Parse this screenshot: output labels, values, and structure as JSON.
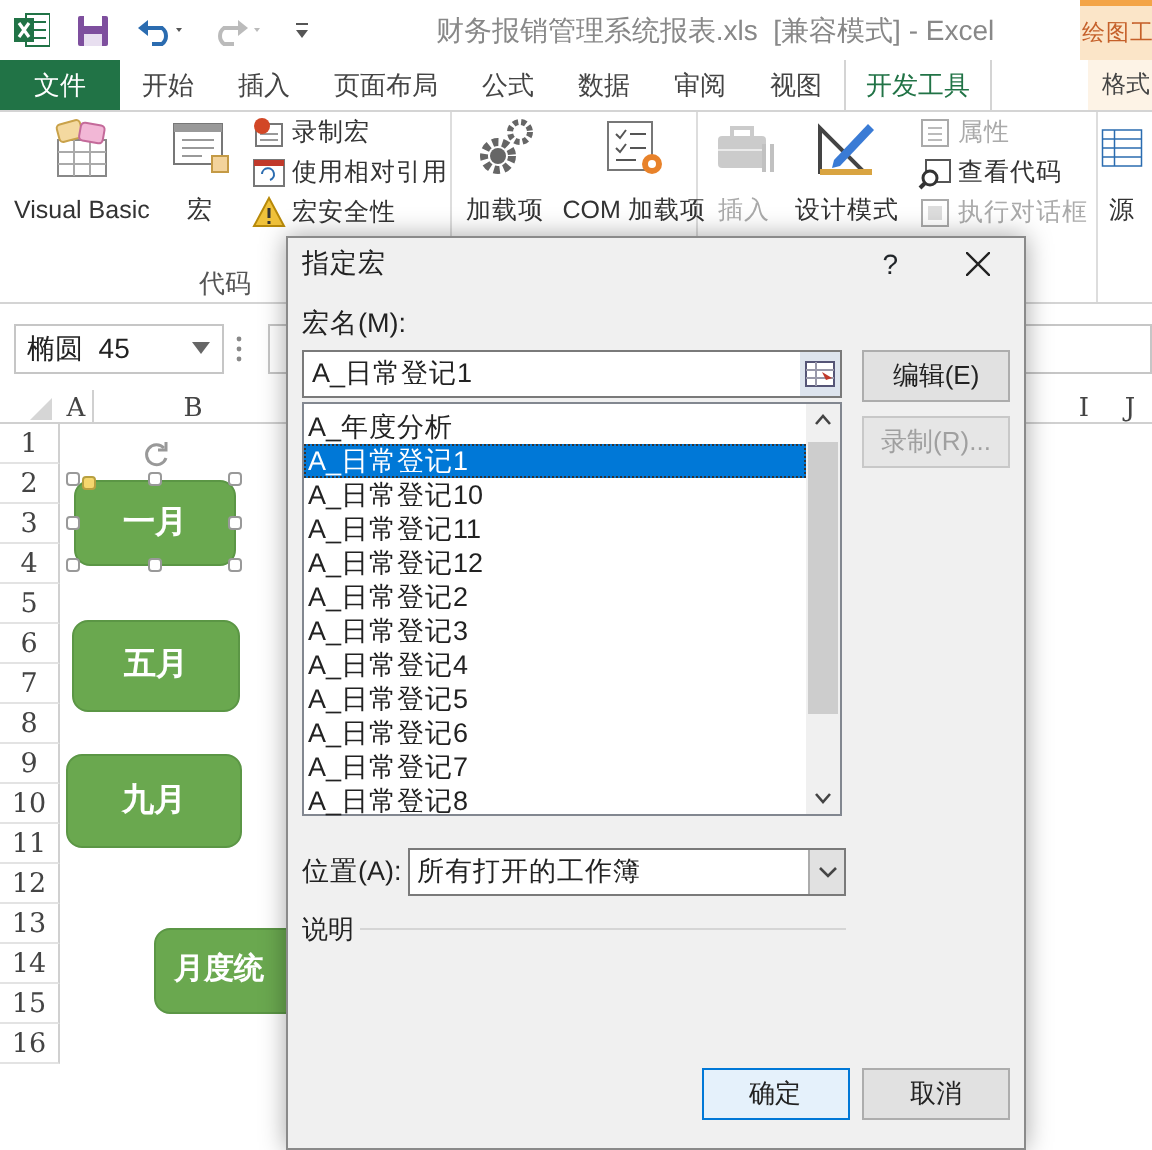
{
  "titlebar": {
    "title": "财务报销管理系统报表.xls  [兼容模式] - Excel",
    "context_tab": "绘图工"
  },
  "ribbon_tabs": [
    {
      "label": "文件",
      "kind": "file",
      "selected": false
    },
    {
      "label": "开始",
      "kind": "tab",
      "selected": false
    },
    {
      "label": "插入",
      "kind": "tab",
      "selected": false
    },
    {
      "label": "页面布局",
      "kind": "tab",
      "selected": false
    },
    {
      "label": "公式",
      "kind": "tab",
      "selected": false
    },
    {
      "label": "数据",
      "kind": "tab",
      "selected": false
    },
    {
      "label": "审阅",
      "kind": "tab",
      "selected": false
    },
    {
      "label": "视图",
      "kind": "tab",
      "selected": false
    },
    {
      "label": "开发工具",
      "kind": "tab",
      "selected": true
    },
    {
      "label": "格式",
      "kind": "context",
      "selected": false
    }
  ],
  "ribbon_groups": [
    {
      "label": "代码",
      "large": [
        {
          "label": "Visual Basic",
          "disabled": false
        },
        {
          "label": "宏",
          "disabled": false
        }
      ],
      "small": [
        {
          "label": "录制宏",
          "disabled": false
        },
        {
          "label": "使用相对引用",
          "disabled": false
        },
        {
          "label": "宏安全性",
          "disabled": false
        }
      ]
    },
    {
      "large": [
        {
          "label": "加载项",
          "disabled": false
        },
        {
          "label": "COM 加载项",
          "disabled": false
        }
      ]
    },
    {
      "large": [
        {
          "label": "插入",
          "disabled": true
        },
        {
          "label": "设计模式",
          "disabled": false
        }
      ],
      "small": [
        {
          "label": "属性",
          "disabled": true
        },
        {
          "label": "查看代码",
          "disabled": false
        },
        {
          "label": "执行对话框",
          "disabled": true
        }
      ]
    },
    {
      "large": [
        {
          "label": "源",
          "disabled": false
        }
      ]
    }
  ],
  "name_box": {
    "value": "椭圆  45"
  },
  "columns": [
    "A",
    "B",
    "I",
    "J"
  ],
  "rows": [
    "1",
    "2",
    "3",
    "4",
    "5",
    "6",
    "7",
    "8",
    "9",
    "10",
    "11",
    "12",
    "13",
    "14",
    "15",
    "16"
  ],
  "shapes": [
    {
      "label": "一月",
      "selected": true
    },
    {
      "label": "五月",
      "selected": false
    },
    {
      "label": "九月",
      "selected": false
    },
    {
      "label": "月度统",
      "selected": false
    }
  ],
  "dialog": {
    "title": "指定宏",
    "help": "?",
    "name_label": "宏名(M):",
    "name_value": "A_日常登记1",
    "macros": [
      {
        "label": "A_年度分析",
        "selected": false
      },
      {
        "label": "A_日常登记1",
        "selected": true
      },
      {
        "label": "A_日常登记10",
        "selected": false
      },
      {
        "label": "A_日常登记11",
        "selected": false
      },
      {
        "label": "A_日常登记12",
        "selected": false
      },
      {
        "label": "A_日常登记2",
        "selected": false
      },
      {
        "label": "A_日常登记3",
        "selected": false
      },
      {
        "label": "A_日常登记4",
        "selected": false
      },
      {
        "label": "A_日常登记5",
        "selected": false
      },
      {
        "label": "A_日常登记6",
        "selected": false
      },
      {
        "label": "A_日常登记7",
        "selected": false
      },
      {
        "label": "A_日常登记8",
        "selected": false
      }
    ],
    "buttons": [
      {
        "label": "编辑(E)",
        "disabled": false
      },
      {
        "label": "录制(R)...",
        "disabled": true
      }
    ],
    "location_label": "位置(A):",
    "location_value": "所有打开的工作簿",
    "description_label": "说明",
    "footer_buttons": [
      {
        "label": "确定",
        "default": true
      },
      {
        "label": "取消",
        "default": false
      }
    ]
  }
}
